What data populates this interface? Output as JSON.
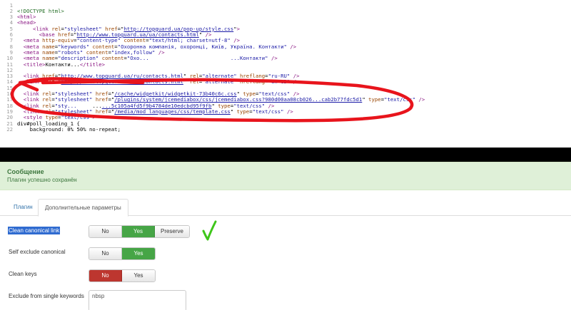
{
  "source": {
    "lines": [
      {
        "n": "1",
        "html": ""
      },
      {
        "n": "2",
        "html": "<span class='c'>&lt;!DOCTYPE html&gt;</span>"
      },
      {
        "n": "3",
        "html": "<span class='t'>&lt;html&gt;</span>"
      },
      {
        "n": "4",
        "html": "<span class='t'>&lt;head&gt;</span>"
      },
      {
        "n": "5",
        "html": "     <span class='t'>&lt;link</span> <span class='a'>rel</span>=<span class='v'>\"stylesheet\"</span> <span class='a'>href</span>=\"<span class='u'>http://topguard.ua/pop-up/style.css</span>\"<span class='t'>&gt;</span>"
      },
      {
        "n": "6",
        "html": "       <span class='t'>&lt;base</span> <span class='a'>href</span>=\"<span class='u'>http://www.topguard.ua/ua/contacts.html</span>\" <span class='t'>/&gt;</span>"
      },
      {
        "n": "7",
        "html": "  <span class='t'>&lt;meta</span> <span class='a'>http-equiv</span>=<span class='v'>\"content-type\"</span> <span class='a'>content</span>=<span class='v'>\"text/html; charset=utf-8\"</span> <span class='t'>/&gt;</span>"
      },
      {
        "n": "8",
        "html": "  <span class='t'>&lt;meta</span> <span class='a'>name</span>=<span class='v'>\"keywords\"</span> <span class='a'>content</span>=<span class='v'>\"Охоронна компанія, охоронці, Київ, Україна. Контакти\"</span> <span class='t'>/&gt;</span>"
      },
      {
        "n": "9",
        "html": "  <span class='t'>&lt;meta</span> <span class='a'>name</span>=<span class='v'>\"robots\"</span> <span class='a'>content</span>=<span class='v'>\"index,follow\"</span> <span class='t'>/&gt;</span>"
      },
      {
        "n": "10",
        "html": "  <span class='t'>&lt;meta</span> <span class='a'>name</span>=<span class='v'>\"description\"</span> <span class='a'>content</span>=<span class='v'>\"Охо...                          ...Контакти\"</span> <span class='t'>/&gt;</span>"
      },
      {
        "n": "11",
        "html": "  <span class='t'>&lt;title&gt;</span>Контакти...<span class='t'>&lt;/title&gt;</span>"
      },
      {
        "n": "12",
        "html": ""
      },
      {
        "n": "13",
        "html": "  <span class='t'>&lt;link</span> <span class='a'>href</span>=\"<span class='u'>http://www.topguard.ua/ru/contacts.html</span>\" <span class='a'>rel</span>=<span class='v'>\"alternate\"</span> <span class='a'>hreflang</span>=<span class='v'>\"ru-RU\"</span> <span class='t'>/&gt;</span>"
      },
      {
        "n": "14",
        "html": "  <span class='t'>&lt;link</span> <span class='a'>href</span>=\"<span class='u'>http://www.topguard.ua/en/contacts.html</span>\" <span class='a'>rel</span>=<span class='v'>\"alternate\"</span> <span class='a'>hreflang</span>=<span class='v'>\"en-GB\"</span> <span class='t'>/&gt;</span>"
      },
      {
        "n": "15",
        "html": ""
      },
      {
        "n": "16",
        "html": "  <span class='t'>&lt;link</span> <span class='a'>rel</span>=<span class='v'>\"stylesheet\"</span> <span class='a'>href</span>=\"<span class='u'>/cache/widgetkit/widgetkit-73b40c6c.css</span>\" <span class='a'>type</span>=<span class='v'>\"text/css\"</span> <span class='t'>/&gt;</span>"
      },
      {
        "n": "17",
        "html": "  <span class='t'>&lt;link</span> <span class='a'>rel</span>=<span class='v'>\"stylesheet\"</span> <span class='a'>href</span>=\"<span class='u'>/plugins/system/jcemediabox/css/jcemediabox.css?980d00aa08cb026...cab2b77fdc5d1</span>\" <span class='a'>type</span>=<span class='v'>\"text/css\"</span> <span class='t'>/&gt;</span>"
      },
      {
        "n": "18",
        "html": "  <span class='t'>&lt;link</span> <span class='a'>rel</span>=<span class='v'>\"sty...</span>     ...<span class='u'>...5c105a4fd5f9b4784de10edcbd95f9fb</span>\" <span class='a'>type</span>=<span class='v'>\"text/css\"</span> <span class='t'>/&gt;</span>"
      },
      {
        "n": "19",
        "html": "  <span class='t'>&lt;link</span> <span class='a'>rel</span>=<span class='v'>\"stylesheet\"</span> <span class='a'>href</span>=\"<span class='u'>/media/mod_languages/css/template.css</span>\" <span class='a'>type</span>=<span class='v'>\"text/css\"</span> <span class='t'>/&gt;</span>"
      },
      {
        "n": "20",
        "html": "  <span class='t'>&lt;style</span> <span class='a'>type</span>=<span class='v'>\"text/css\"</span><span class='t'>&gt;</span>"
      },
      {
        "n": "21",
        "html": "div#poll_loading_1 {"
      },
      {
        "n": "22",
        "html": "    background: 0% 50% no-repeat;"
      }
    ]
  },
  "alert": {
    "heading": "Сообщение",
    "text": "Плагин успешно сохранён"
  },
  "tabs": {
    "plugin": "Плагин",
    "advanced": "Дополнительные параметры"
  },
  "fields": {
    "canonical": {
      "label": "Clean canonical link",
      "options": [
        "No",
        "Yes",
        "Preserve"
      ],
      "selected": "Yes"
    },
    "self_exclude": {
      "label": "Self exclude canonical",
      "options": [
        "No",
        "Yes"
      ],
      "selected": "Yes"
    },
    "clean_keys": {
      "label": "Clean keys",
      "options": [
        "No",
        "Yes"
      ],
      "selected": "No"
    },
    "exclude_single": {
      "label": "Exclude from single keywords",
      "value": "nbsp"
    }
  },
  "colors": {
    "annotation_red": "#e8141c",
    "annotation_green": "#3ec61a",
    "selected_green": "#46a546",
    "selected_red": "#bd362f",
    "alert_bg": "#dff0d8"
  }
}
